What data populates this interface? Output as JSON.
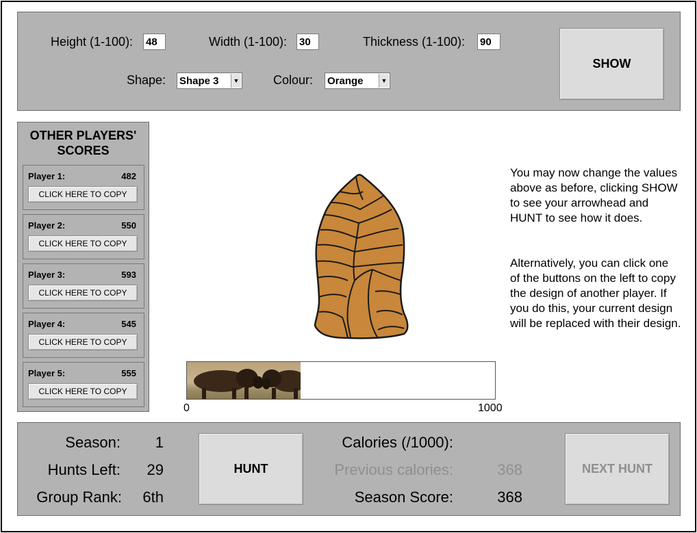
{
  "controls": {
    "height_label": "Height (1-100):",
    "height_value": "48",
    "width_label": "Width (1-100):",
    "width_value": "30",
    "thickness_label": "Thickness (1-100):",
    "thickness_value": "90",
    "shape_label": "Shape:",
    "shape_value": "Shape 3",
    "colour_label": "Colour:",
    "colour_value": "Orange",
    "show_button": "SHOW"
  },
  "other_players": {
    "title_line1": "OTHER PLAYERS'",
    "title_line2": "SCORES",
    "copy_label": "CLICK HERE TO COPY",
    "players": [
      {
        "name": "Player 1:",
        "score": "482"
      },
      {
        "name": "Player 2:",
        "score": "550"
      },
      {
        "name": "Player 3:",
        "score": "593"
      },
      {
        "name": "Player 4:",
        "score": "545"
      },
      {
        "name": "Player 5:",
        "score": "555"
      }
    ]
  },
  "arrowhead": {
    "color": "#c8873a",
    "icon": "arrowhead-icon"
  },
  "calorie_bar": {
    "min_label": "0",
    "max_label": "1000",
    "value": 368,
    "max": 1000
  },
  "info": {
    "paragraph1": "You may now change the values above as before, clicking SHOW to see your arrowhead and HUNT to see how it does.",
    "paragraph2": "Alternatively, you can click one of the buttons on the left to copy the design of another player. If you do this, your current design will be replaced with their design."
  },
  "status": {
    "season_label": "Season:",
    "season_value": "1",
    "hunts_left_label": "Hunts Left:",
    "hunts_left_value": "29",
    "group_rank_label": "Group Rank:",
    "group_rank_value": "6th",
    "hunt_button": "HUNT",
    "calories_label": "Calories (/1000):",
    "previous_calories_label": "Previous calories:",
    "previous_calories_value": "368",
    "season_score_label": "Season Score:",
    "season_score_value": "368",
    "next_hunt_button": "NEXT HUNT"
  },
  "colors": {
    "panel": "#b3b3b3",
    "button": "#dcdcdc",
    "disabled_text": "#8f8f8f"
  }
}
